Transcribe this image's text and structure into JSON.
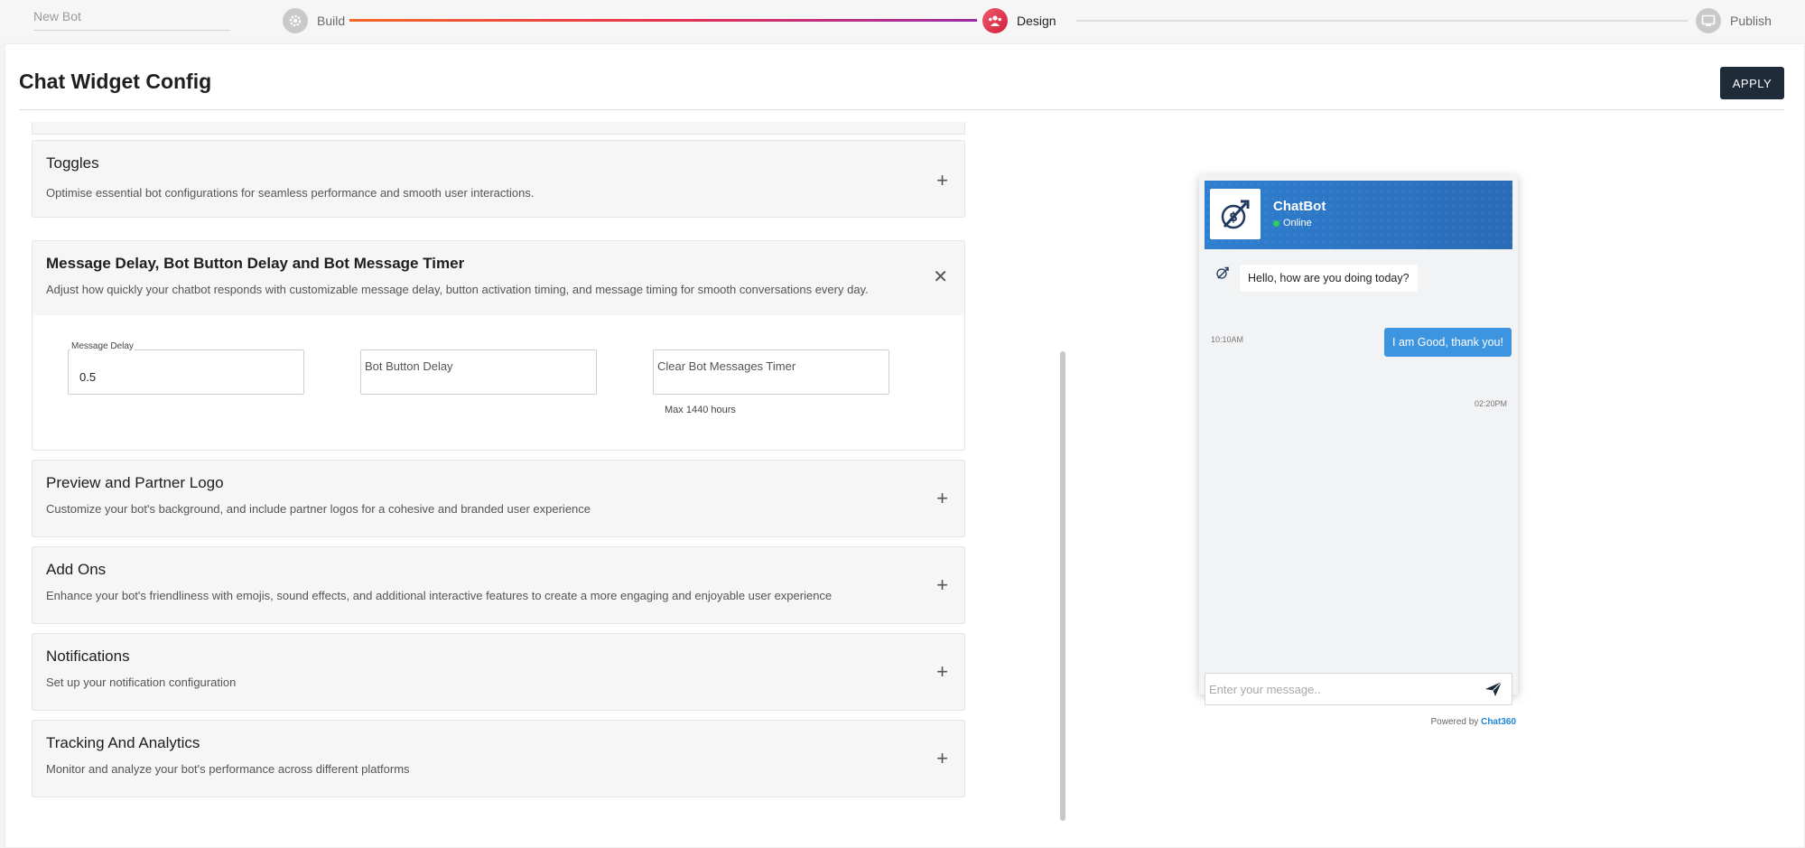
{
  "topbar": {
    "bot_name": "New Bot",
    "steps": [
      {
        "label": "Build",
        "icon": "gear-icon",
        "state": "done"
      },
      {
        "label": "Design",
        "icon": "users-icon",
        "state": "active"
      },
      {
        "label": "Publish",
        "icon": "monitor-icon",
        "state": "pending"
      }
    ]
  },
  "header": {
    "title": "Chat Widget Config",
    "apply_label": "APPLY"
  },
  "sections": [
    {
      "title": "Toggles",
      "description": "Optimise essential bot configurations for seamless performance and smooth user interactions.",
      "expanded": false
    },
    {
      "title": "Message Delay, Bot Button Delay and Bot Message Timer",
      "description": "Adjust how quickly your chatbot responds with customizable message delay, button activation timing, and message timing for smooth conversations every day.",
      "expanded": true
    },
    {
      "title": "Preview and Partner Logo",
      "description": "Customize your bot's background, and include partner logos for a cohesive and branded user experience",
      "expanded": false
    },
    {
      "title": "Add Ons",
      "description": "Enhance your bot's friendliness with emojis, sound effects, and additional interactive features to create a more engaging and enjoyable user experience",
      "expanded": false
    },
    {
      "title": "Notifications",
      "description": "Set up your notification configuration",
      "expanded": false
    },
    {
      "title": "Tracking And Analytics",
      "description": "Monitor and analyze your bot's performance across different platforms",
      "expanded": false
    }
  ],
  "delay_fields": {
    "message_delay": {
      "label": "Message Delay",
      "value": "0.5"
    },
    "bot_button_delay": {
      "placeholder": "Bot Button Delay",
      "value": ""
    },
    "clear_timer": {
      "placeholder": "Clear Bot Messages Timer",
      "value": "",
      "hint": "Max 1440 hours"
    }
  },
  "chat_preview": {
    "bot_name": "ChatBot",
    "status": "Online",
    "bot_message": "Hello, how are you doing today?",
    "bot_time": "10:10AM",
    "user_message": "I am Good, thank you!",
    "user_time": "02:20PM",
    "input_placeholder": "Enter your message..",
    "powered_prefix": "Powered by",
    "powered_brand": "Chat360",
    "colors": {
      "header": "#2f7fd0",
      "user_bubble": "#3d95e0",
      "online": "#2fcf5a"
    }
  },
  "colors": {
    "apply_button": "#1f2b39",
    "progress_start": "#f26a2a",
    "progress_end": "#9b2ba8",
    "active_step": "#d0203e"
  }
}
